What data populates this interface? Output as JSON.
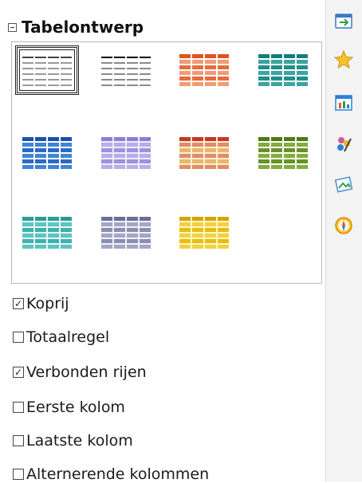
{
  "deck": {
    "title": "Tabelontwerp"
  },
  "options": [
    {
      "label": "Koprij",
      "checked": true
    },
    {
      "label": "Totaalregel",
      "checked": false
    },
    {
      "label": "Verbonden rijen",
      "checked": true
    },
    {
      "label": "Eerste kolom",
      "checked": false
    },
    {
      "label": "Laatste kolom",
      "checked": false
    },
    {
      "label": "Alternerende kolommen",
      "checked": false
    }
  ],
  "table_styles": [
    {
      "name": "default",
      "header": "#444444",
      "body": "#9a9a9a",
      "alt": "#777777",
      "bg": "#ffffff"
    },
    {
      "name": "black",
      "header": "#000000",
      "body": "#8a8a8a",
      "alt": "#555555",
      "bg": "#ffffff"
    },
    {
      "name": "orange",
      "header": "#e2521d",
      "body": "#f29a77",
      "alt": "#e56d3b",
      "bg": "#ffffff"
    },
    {
      "name": "teal",
      "header": "#147d79",
      "body": "#3aa5a0",
      "alt": "#1f8f8a",
      "bg": "#ffffff"
    },
    {
      "name": "blue",
      "header": "#1c4fb0",
      "body": "#3e86d6",
      "alt": "#2c6ac4",
      "bg": "#ffffff"
    },
    {
      "name": "lavender",
      "header": "#8a7fd6",
      "body": "#b6aee8",
      "alt": "#9c92de",
      "bg": "#efedfb"
    },
    {
      "name": "red-yellow",
      "header": "#c1382a",
      "body": "#e38a6e",
      "alt": "#e8b66d",
      "bg": "#fbf1cf"
    },
    {
      "name": "olive",
      "header": "#4d7a18",
      "body": "#82ad3c",
      "alt": "#6a9128",
      "bg": "#ffffff"
    },
    {
      "name": "aqua",
      "header": "#2b9c9a",
      "body": "#5cc4c2",
      "alt": "#3fb0ad",
      "bg": "#e9f7f7"
    },
    {
      "name": "slate",
      "header": "#6a6f9a",
      "body": "#a3a6c4",
      "alt": "#8a8eb3",
      "bg": "#f2f2f8"
    },
    {
      "name": "yellow",
      "header": "#d8a300",
      "body": "#f2cf47",
      "alt": "#e9bb14",
      "bg": "#fff8c2"
    }
  ],
  "tabbar_icons": [
    {
      "name": "properties-icon",
      "color": "#4aa0e0"
    },
    {
      "name": "star-icon",
      "color": "#f2b21b"
    },
    {
      "name": "chart-icon",
      "color": "#2f7fd8"
    },
    {
      "name": "styles-icon",
      "color": "#d65a9a"
    },
    {
      "name": "gallery-icon",
      "color": "#38a04c"
    },
    {
      "name": "navigator-icon",
      "color": "#e8941a"
    }
  ]
}
